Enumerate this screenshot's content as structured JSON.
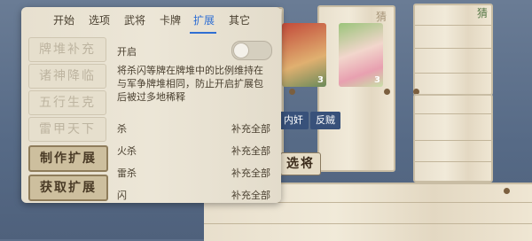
{
  "tabs": [
    {
      "label": "开始",
      "active": false
    },
    {
      "label": "选项",
      "active": false
    },
    {
      "label": "武将",
      "active": false
    },
    {
      "label": "卡牌",
      "active": false
    },
    {
      "label": "扩展",
      "active": true
    },
    {
      "label": "其它",
      "active": false
    }
  ],
  "sidebar": [
    {
      "label": "牌堆补充",
      "state": "faded"
    },
    {
      "label": "诸神降临",
      "state": "faded"
    },
    {
      "label": "五行生克",
      "state": "faded"
    },
    {
      "label": "雷甲天下",
      "state": "faded"
    },
    {
      "label": "制作扩展",
      "state": "active"
    },
    {
      "label": "获取扩展",
      "state": "active"
    }
  ],
  "setting": {
    "label": "开启",
    "enabled": false,
    "description": "将杀闪等牌在牌堆中的比例维持在与军争牌堆相同，防止开启扩展包后被过多地稀释"
  },
  "card_rows": [
    {
      "name": "杀",
      "action": "补充全部"
    },
    {
      "name": "火杀",
      "action": "补充全部"
    },
    {
      "name": "雷杀",
      "action": "补充全部"
    },
    {
      "name": "闪",
      "action": "补充全部"
    }
  ],
  "game": {
    "select_label": "选将",
    "role_tags": [
      "内奸",
      "反贼"
    ],
    "card_counts": [
      "3",
      "3"
    ],
    "corner_glyph": "猜",
    "corner_glyph_2": "猜"
  },
  "colors": {
    "accent": "#2f6fd3",
    "tag_red": "#b3382f",
    "tag_blue": "#38517a"
  }
}
